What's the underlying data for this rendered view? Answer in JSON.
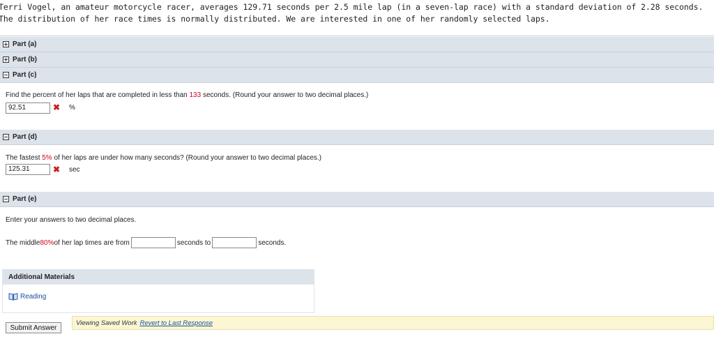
{
  "intro": {
    "text": "Terri Vogel, an amateur motorcycle racer, averages 129.71 seconds per 2.5 mile lap (in a seven-lap race) with a standard deviation of 2.28 seconds. The distribution of her race times is normally distributed. We are interested in one of her randomly selected laps."
  },
  "parts": {
    "a": {
      "label": "Part (a)",
      "state": "collapsed"
    },
    "b": {
      "label": "Part (b)",
      "state": "collapsed"
    },
    "c": {
      "label": "Part (c)",
      "state": "expanded",
      "question_pre": "Find the percent of her laps that are completed in less than ",
      "question_hl": "133",
      "question_post": " seconds. (Round your answer to two decimal places.)",
      "answer": "92.51",
      "unit": "%",
      "status_icon": "x-icon"
    },
    "d": {
      "label": "Part (d)",
      "state": "expanded",
      "question_pre": "The fastest ",
      "question_hl": "5%",
      "question_post": " of her laps are under how many seconds? (Round your answer to two decimal places.)",
      "answer": "125.31",
      "unit": "sec",
      "status_icon": "x-icon"
    },
    "e": {
      "label": "Part (e)",
      "state": "expanded",
      "instruction": "Enter your answers to two decimal places.",
      "q_pre": "The middle ",
      "q_hl": "80%",
      "q_mid": " of her lap times are from",
      "q_to": "seconds to",
      "q_end": "seconds.",
      "from_value": "",
      "to_value": ""
    }
  },
  "materials": {
    "title": "Additional Materials",
    "reading_label": "Reading",
    "reading_icon": "book-icon"
  },
  "footer": {
    "submit_label": "Submit Answer",
    "saved_text": "Viewing Saved Work",
    "revert_label": "Revert to Last Response"
  },
  "colors": {
    "highlight": "#d0021b",
    "header_bg": "#dde3ea",
    "link": "#1a4fa0",
    "saved_bg": "#fbf7d5"
  }
}
